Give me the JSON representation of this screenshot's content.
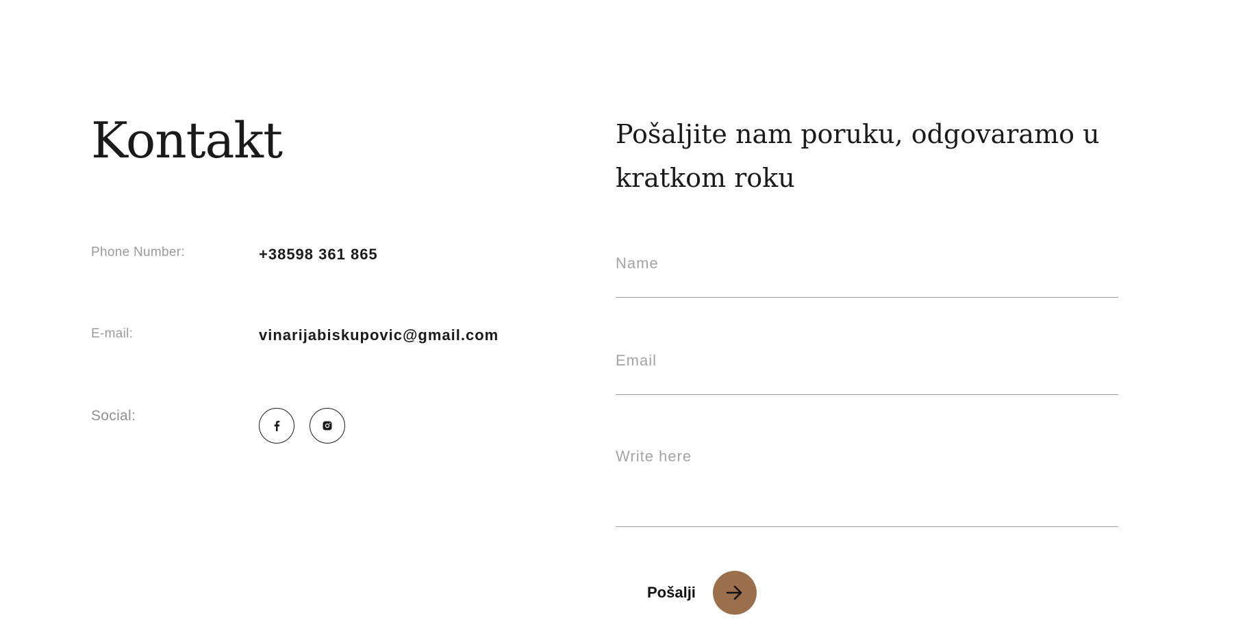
{
  "contact": {
    "title": "Kontakt",
    "phone_label": "Phone Number:",
    "phone_value": "+38598 361 865",
    "email_label": "E-mail:",
    "email_value": "vinarijabiskupovic@gmail.com",
    "social_label": "Social:",
    "social_icons": [
      "facebook-icon",
      "instagram-icon"
    ]
  },
  "form": {
    "heading": "Pošaljite nam poruku, odgovaramo u kratkom roku",
    "name_placeholder": "Name",
    "email_placeholder": "Email",
    "message_placeholder": "Write here",
    "submit_label": "Pošalji",
    "submit_icon": "arrow-right-icon"
  },
  "colors": {
    "accent": "#9b6f4b",
    "text": "#1a1a1a",
    "muted": "#9a9a9a"
  }
}
